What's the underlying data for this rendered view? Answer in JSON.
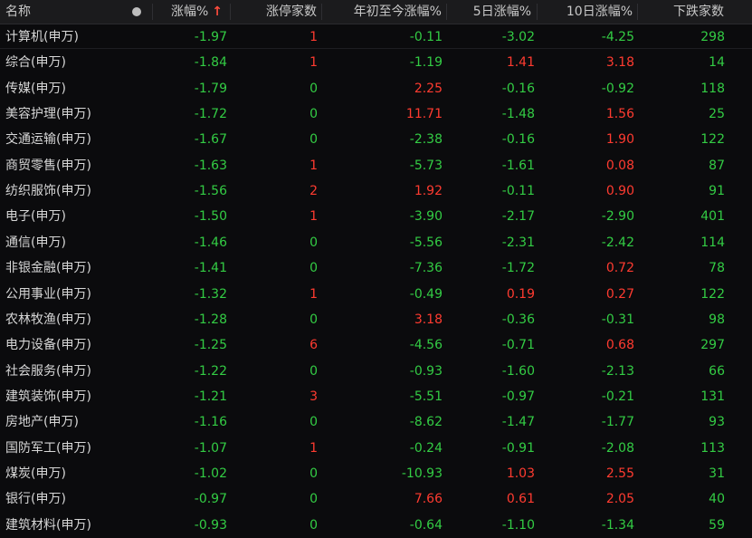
{
  "header": {
    "name": "名称",
    "change": "涨幅%",
    "sort_arrow": "↑",
    "limit_up": "涨停家数",
    "ytd": "年初至今涨幅%",
    "d5": "5日涨幅%",
    "d10": "10日涨幅%",
    "down": "下跌家数"
  },
  "colors": {
    "up": "#ff3b30",
    "down": "#33cc44",
    "background": "#0b0b0d",
    "header_bg": "#1b1b1d"
  },
  "rows": [
    {
      "name": "计算机(申万)",
      "change": "-1.97",
      "limit_up": "1",
      "ytd": "-0.11",
      "d5": "-3.02",
      "d10": "-4.25",
      "down": "298"
    },
    {
      "name": "综合(申万)",
      "change": "-1.84",
      "limit_up": "1",
      "ytd": "-1.19",
      "d5": "1.41",
      "d10": "3.18",
      "down": "14"
    },
    {
      "name": "传媒(申万)",
      "change": "-1.79",
      "limit_up": "0",
      "ytd": "2.25",
      "d5": "-0.16",
      "d10": "-0.92",
      "down": "118"
    },
    {
      "name": "美容护理(申万)",
      "change": "-1.72",
      "limit_up": "0",
      "ytd": "11.71",
      "d5": "-1.48",
      "d10": "1.56",
      "down": "25"
    },
    {
      "name": "交通运输(申万)",
      "change": "-1.67",
      "limit_up": "0",
      "ytd": "-2.38",
      "d5": "-0.16",
      "d10": "1.90",
      "down": "122"
    },
    {
      "name": "商贸零售(申万)",
      "change": "-1.63",
      "limit_up": "1",
      "ytd": "-5.73",
      "d5": "-1.61",
      "d10": "0.08",
      "down": "87"
    },
    {
      "name": "纺织服饰(申万)",
      "change": "-1.56",
      "limit_up": "2",
      "ytd": "1.92",
      "d5": "-0.11",
      "d10": "0.90",
      "down": "91"
    },
    {
      "name": "电子(申万)",
      "change": "-1.50",
      "limit_up": "1",
      "ytd": "-3.90",
      "d5": "-2.17",
      "d10": "-2.90",
      "down": "401"
    },
    {
      "name": "通信(申万)",
      "change": "-1.46",
      "limit_up": "0",
      "ytd": "-5.56",
      "d5": "-2.31",
      "d10": "-2.42",
      "down": "114"
    },
    {
      "name": "非银金融(申万)",
      "change": "-1.41",
      "limit_up": "0",
      "ytd": "-7.36",
      "d5": "-1.72",
      "d10": "0.72",
      "down": "78"
    },
    {
      "name": "公用事业(申万)",
      "change": "-1.32",
      "limit_up": "1",
      "ytd": "-0.49",
      "d5": "0.19",
      "d10": "0.27",
      "down": "122"
    },
    {
      "name": "农林牧渔(申万)",
      "change": "-1.28",
      "limit_up": "0",
      "ytd": "3.18",
      "d5": "-0.36",
      "d10": "-0.31",
      "down": "98"
    },
    {
      "name": "电力设备(申万)",
      "change": "-1.25",
      "limit_up": "6",
      "ytd": "-4.56",
      "d5": "-0.71",
      "d10": "0.68",
      "down": "297"
    },
    {
      "name": "社会服务(申万)",
      "change": "-1.22",
      "limit_up": "0",
      "ytd": "-0.93",
      "d5": "-1.60",
      "d10": "-2.13",
      "down": "66"
    },
    {
      "name": "建筑装饰(申万)",
      "change": "-1.21",
      "limit_up": "3",
      "ytd": "-5.51",
      "d5": "-0.97",
      "d10": "-0.21",
      "down": "131"
    },
    {
      "name": "房地产(申万)",
      "change": "-1.16",
      "limit_up": "0",
      "ytd": "-8.62",
      "d5": "-1.47",
      "d10": "-1.77",
      "down": "93"
    },
    {
      "name": "国防军工(申万)",
      "change": "-1.07",
      "limit_up": "1",
      "ytd": "-0.24",
      "d5": "-0.91",
      "d10": "-2.08",
      "down": "113"
    },
    {
      "name": "煤炭(申万)",
      "change": "-1.02",
      "limit_up": "0",
      "ytd": "-10.93",
      "d5": "1.03",
      "d10": "2.55",
      "down": "31"
    },
    {
      "name": "银行(申万)",
      "change": "-0.97",
      "limit_up": "0",
      "ytd": "7.66",
      "d5": "0.61",
      "d10": "2.05",
      "down": "40"
    },
    {
      "name": "建筑材料(申万)",
      "change": "-0.93",
      "limit_up": "0",
      "ytd": "-0.64",
      "d5": "-1.10",
      "d10": "-1.34",
      "down": "59"
    }
  ]
}
